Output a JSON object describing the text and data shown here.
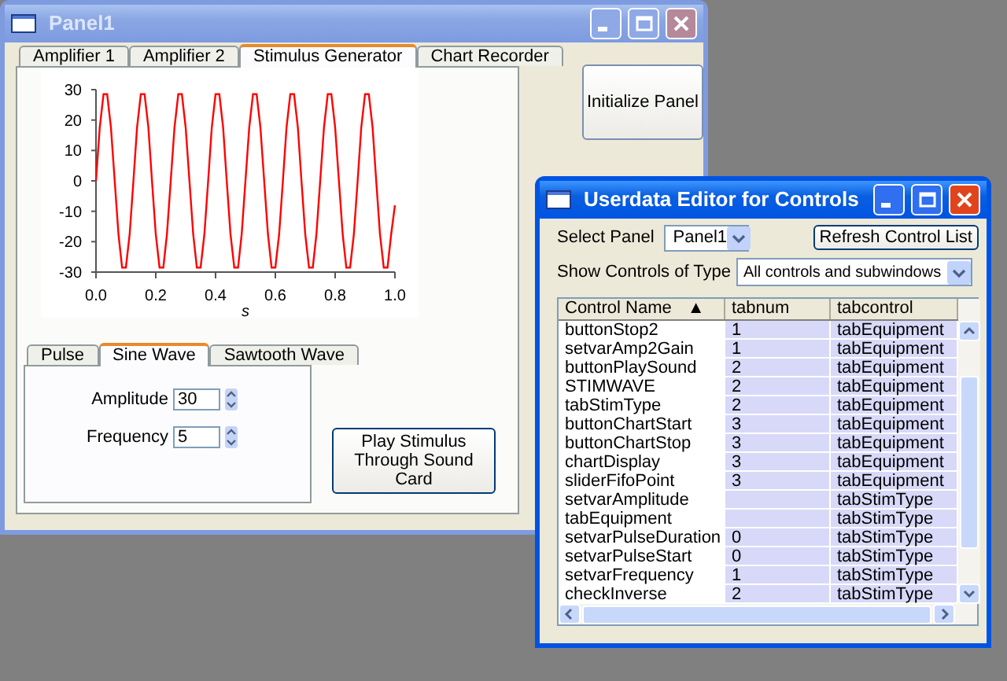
{
  "panel_window": {
    "title": "Panel1",
    "active": false,
    "tabs": [
      {
        "label": "Amplifier 1",
        "selected": false
      },
      {
        "label": "Amplifier 2",
        "selected": false
      },
      {
        "label": "Stimulus Generator",
        "selected": true
      },
      {
        "label": "Chart Recorder",
        "selected": false
      }
    ],
    "chart_data": {
      "type": "line",
      "xlabel": "s",
      "xlim": [
        0,
        1
      ],
      "ylim": [
        -30,
        30
      ],
      "xticks": [
        {
          "value": 0,
          "label": "0.0"
        },
        {
          "value": 0.2,
          "label": "0.2"
        },
        {
          "value": 0.4,
          "label": "0.4"
        },
        {
          "value": 0.6,
          "label": "0.6"
        },
        {
          "value": 0.8,
          "label": "0.8"
        },
        {
          "value": 1,
          "label": "1.0"
        }
      ],
      "yticks": [
        30,
        20,
        10,
        0,
        -10,
        -20,
        -30
      ],
      "x": [
        0,
        0.0125,
        0.025,
        0.0375,
        0.05,
        0.0625,
        0.075,
        0.0875,
        0.1,
        0.1125,
        0.125,
        0.1375,
        0.15,
        0.1625,
        0.175,
        0.1875,
        0.2,
        0.2125,
        0.225,
        0.2375,
        0.25,
        0.2625,
        0.275,
        0.2875,
        0.3,
        0.3125,
        0.325,
        0.3375,
        0.35,
        0.3625,
        0.375,
        0.3875,
        0.4,
        0.4125,
        0.425,
        0.4375,
        0.45,
        0.4625,
        0.475,
        0.4875,
        0.5,
        0.5125,
        0.525,
        0.5375,
        0.55,
        0.5625,
        0.575,
        0.5875,
        0.6,
        0.6125,
        0.625,
        0.6375,
        0.65,
        0.6625,
        0.675,
        0.6875,
        0.7,
        0.7125,
        0.725,
        0.7375,
        0.75,
        0.7625,
        0.775,
        0.7875,
        0.8,
        0.8125,
        0.825,
        0.8375,
        0.85,
        0.8625,
        0.875,
        0.8875,
        0.9,
        0.9125,
        0.925,
        0.9375,
        0.95,
        0.9625,
        0.975,
        0.9875,
        1
      ],
      "series": [
        {
          "color": "#ff0000",
          "values": [
            0,
            17.6,
            28.5,
            28.5,
            17.6,
            0,
            -17.6,
            -28.5,
            -28.5,
            -17.6,
            0,
            17.6,
            28.5,
            28.5,
            17.6,
            0,
            -17.6,
            -28.5,
            -28.5,
            -17.6,
            0,
            17.6,
            28.5,
            28.5,
            17.6,
            0,
            -17.6,
            -28.5,
            -28.5,
            -17.6,
            0,
            17.6,
            28.5,
            28.5,
            17.6,
            0,
            -17.6,
            -28.5,
            -28.5,
            -17.6,
            0,
            17.6,
            28.5,
            28.5,
            17.6,
            0,
            -17.6,
            -28.5,
            -28.5,
            -17.6,
            0,
            17.6,
            28.5,
            28.5,
            17.6,
            0,
            -17.6,
            -28.5,
            -28.5,
            -17.6,
            0,
            17.6,
            28.5,
            28.5,
            17.6,
            0,
            -17.6,
            -28.5,
            -28.5,
            -17.6,
            0,
            17.6,
            28.5,
            28.5,
            17.6,
            0,
            -17.6,
            -28.5,
            -28.5,
            -17.6,
            -8
          ]
        }
      ]
    },
    "initialize_button": "Initialize Panel",
    "stim_tabs": [
      {
        "label": "Pulse",
        "selected": false
      },
      {
        "label": "Sine Wave",
        "selected": true
      },
      {
        "label": "Sawtooth Wave",
        "selected": false
      }
    ],
    "fields": [
      {
        "label": "Amplitude",
        "value": "30"
      },
      {
        "label": "Frequency",
        "value": "5"
      }
    ],
    "play_button": "Play Stimulus Through Sound Card"
  },
  "editor_window": {
    "title": "Userdata Editor for Controls",
    "active": true,
    "select_panel": {
      "label": "Select Panel",
      "value": "Panel1"
    },
    "refresh_button": "Refresh Control List",
    "show_type": {
      "label": "Show Controls of Type",
      "value": "All controls and subwindows"
    },
    "table": {
      "columns": [
        {
          "label": "Control Name",
          "sort_indicator": "▲"
        },
        {
          "label": "tabnum"
        },
        {
          "label": "tabcontrol"
        }
      ],
      "rows": [
        [
          "buttonStop2",
          "1",
          "tabEquipment"
        ],
        [
          "setvarAmp2Gain",
          "1",
          "tabEquipment"
        ],
        [
          "buttonPlaySound",
          "2",
          "tabEquipment"
        ],
        [
          "STIMWAVE",
          "2",
          "tabEquipment"
        ],
        [
          "tabStimType",
          "2",
          "tabEquipment"
        ],
        [
          "buttonChartStart",
          "3",
          "tabEquipment"
        ],
        [
          "buttonChartStop",
          "3",
          "tabEquipment"
        ],
        [
          "chartDisplay",
          "3",
          "tabEquipment"
        ],
        [
          "sliderFifoPoint",
          "3",
          "tabEquipment"
        ],
        [
          "setvarAmplitude",
          "",
          "tabStimType"
        ],
        [
          "tabEquipment",
          "",
          "tabStimType"
        ],
        [
          "setvarPulseDuration",
          "0",
          "tabStimType"
        ],
        [
          "setvarPulseStart",
          "0",
          "tabStimType"
        ],
        [
          "setvarFrequency",
          "1",
          "tabStimType"
        ],
        [
          "checkInverse",
          "2",
          "tabStimType"
        ]
      ]
    }
  }
}
